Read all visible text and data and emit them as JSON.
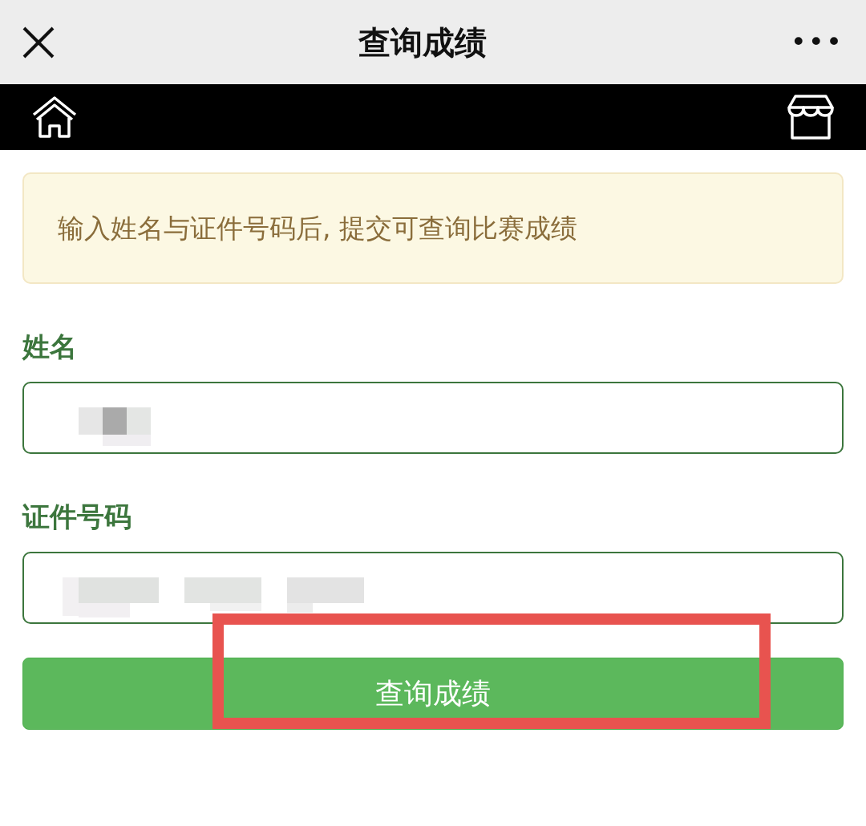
{
  "title_bar": {
    "title": "查询成绩",
    "more": "•••"
  },
  "notice": "输入姓名与证件号码后, 提交可查询比赛成绩",
  "fields": [
    {
      "label": "姓名",
      "redacted": true
    },
    {
      "label": "证件号码",
      "redacted": true
    }
  ],
  "submit_button": {
    "label": "查询成绩",
    "highlighted": true
  }
}
